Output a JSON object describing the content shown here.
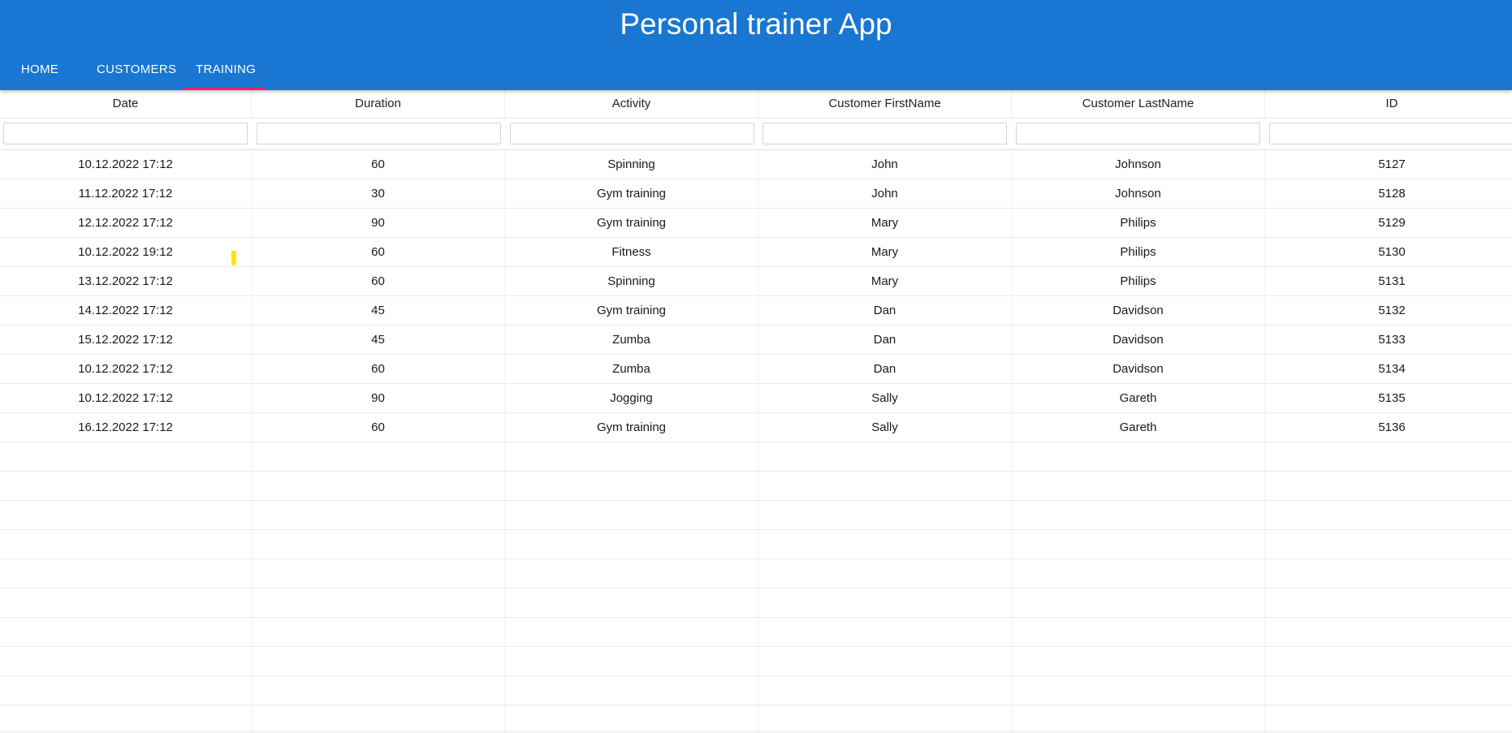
{
  "app": {
    "title": "Personal trainer App",
    "accent_color": "#1976d2",
    "indicator_color": "#e91e63"
  },
  "tabs": [
    {
      "label": "HOME",
      "active": false
    },
    {
      "label": "CUSTOMERS",
      "active": false
    },
    {
      "label": "TRAINING",
      "active": true
    }
  ],
  "table": {
    "columns": [
      "Date",
      "Duration",
      "Activity",
      "Customer FirstName",
      "Customer LastName",
      "ID"
    ],
    "filters": [
      "",
      "",
      "",
      "",
      "",
      ""
    ],
    "rows": [
      [
        "10.12.2022 17:12",
        "60",
        "Spinning",
        "John",
        "Johnson",
        "5127"
      ],
      [
        "11.12.2022 17:12",
        "30",
        "Gym training",
        "John",
        "Johnson",
        "5128"
      ],
      [
        "12.12.2022 17:12",
        "90",
        "Gym training",
        "Mary",
        "Philips",
        "5129"
      ],
      [
        "10.12.2022 19:12",
        "60",
        "Fitness",
        "Mary",
        "Philips",
        "5130"
      ],
      [
        "13.12.2022 17:12",
        "60",
        "Spinning",
        "Mary",
        "Philips",
        "5131"
      ],
      [
        "14.12.2022 17:12",
        "45",
        "Gym training",
        "Dan",
        "Davidson",
        "5132"
      ],
      [
        "15.12.2022 17:12",
        "45",
        "Zumba",
        "Dan",
        "Davidson",
        "5133"
      ],
      [
        "10.12.2022 17:12",
        "60",
        "Zumba",
        "Dan",
        "Davidson",
        "5134"
      ],
      [
        "10.12.2022 17:12",
        "90",
        "Jogging",
        "Sally",
        "Gareth",
        "5135"
      ],
      [
        "16.12.2022 17:12",
        "60",
        "Gym training",
        "Sally",
        "Gareth",
        "5136"
      ]
    ]
  }
}
